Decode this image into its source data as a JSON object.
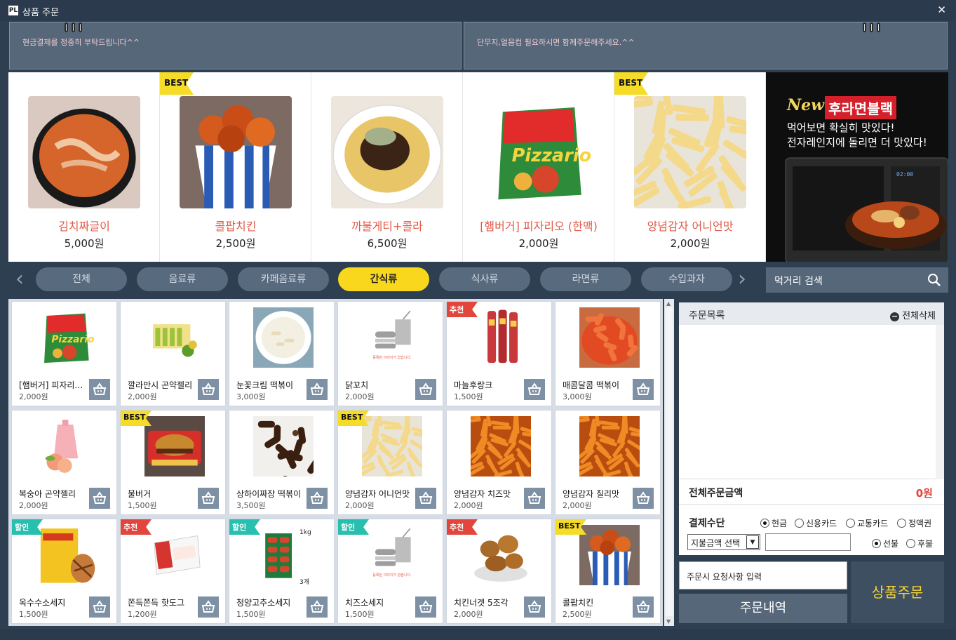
{
  "window": {
    "title": "상품 주문",
    "close_label": "✕"
  },
  "notices": [
    "현금결제를 정중히 부탁드립니다^^",
    "단무지,얼음컵 필요하시면 함께주문해주세요.^^"
  ],
  "featured": [
    {
      "name": "김치짜글이",
      "price": "5,000원",
      "badge": "",
      "img": "stew"
    },
    {
      "name": "콜팝치킨",
      "price": "2,500원",
      "badge": "BEST",
      "img": "cup"
    },
    {
      "name": "까불게티+콜라",
      "price": "6,500원",
      "badge": "",
      "img": "noodle"
    },
    {
      "name": "[햄버거] 피자리오 (한맥)",
      "price": "2,000원",
      "badge": "",
      "img": "package"
    },
    {
      "name": "양념감자 어니언맛",
      "price": "2,000원",
      "badge": "BEST",
      "img": "fries"
    }
  ],
  "banner": {
    "new_label": "New",
    "product": "후라면블랙",
    "line1": "먹어보면 확실히 맛있다!",
    "line2": "전자레인지에 돌리면 더 맛있다!",
    "clock": "02:00"
  },
  "categories": [
    "전체",
    "음료류",
    "카페음료류",
    "간식류",
    "식사류",
    "라면류",
    "수입과자"
  ],
  "active_category": 3,
  "search": {
    "placeholder": "먹거리 검색"
  },
  "items": [
    {
      "name": "[햄버거] 피자리오 (한맥)",
      "price": "2,000원",
      "tag": "",
      "img": "package"
    },
    {
      "name": "깔라만시 곤약젤리",
      "price": "2,000원",
      "tag": "",
      "img": "jellybox"
    },
    {
      "name": "눈꽃크림 떡볶이",
      "price": "3,000원",
      "tag": "",
      "img": "creamtteok"
    },
    {
      "name": "닭꼬치",
      "price": "2,000원",
      "tag": "",
      "img": "placeholder"
    },
    {
      "name": "마늘후랑크",
      "price": "1,500원",
      "tag": "추천",
      "img": "sausages"
    },
    {
      "name": "매콤달콤 떡볶이",
      "price": "3,000원",
      "tag": "",
      "img": "tteok"
    },
    {
      "name": "복숭아 곤약젤리",
      "price": "2,000원",
      "tag": "",
      "img": "peach"
    },
    {
      "name": "불버거",
      "price": "1,500원",
      "tag": "BEST",
      "img": "burger"
    },
    {
      "name": "상하이짜장 떡볶이",
      "price": "3,500원",
      "tag": "",
      "img": "jjajang"
    },
    {
      "name": "양념감자 어니언맛",
      "price": "2,000원",
      "tag": "BEST",
      "img": "fries"
    },
    {
      "name": "양념감자 치즈맛",
      "price": "2,000원",
      "tag": "",
      "img": "friesorange"
    },
    {
      "name": "양념감자 칠리맛",
      "price": "2,000원",
      "tag": "",
      "img": "friesorange"
    },
    {
      "name": "옥수수소세지",
      "price": "1,500원",
      "tag": "할인",
      "img": "corndog"
    },
    {
      "name": "쫀득쫀득 핫도그",
      "price": "1,200원",
      "tag": "추천",
      "img": "hotdog"
    },
    {
      "name": "청양고추소세지",
      "price": "1,500원",
      "tag": "할인",
      "img": "greenbox"
    },
    {
      "name": "치즈소세지",
      "price": "1,500원",
      "tag": "할인",
      "img": "placeholder"
    },
    {
      "name": "치킨너겟 5조각",
      "price": "2,000원",
      "tag": "추천",
      "img": "nuggets"
    },
    {
      "name": "콜팝치킨",
      "price": "2,500원",
      "tag": "BEST",
      "img": "cup"
    }
  ],
  "image_texts": {
    "placeholder": "등록된 이미지가 없습니다.",
    "greenbox_weight": "1kg",
    "greenbox_count": "3개"
  },
  "order": {
    "header": "주문목록",
    "clear_label": "전체삭제",
    "total_label": "전체주문금액",
    "total_value": "0원",
    "pay_label": "결제수단",
    "methods": [
      "현금",
      "신용카드",
      "교통카드",
      "정액권"
    ],
    "selected_method": 0,
    "amount_select": "지불금액 선택",
    "timing": [
      "선불",
      "후불"
    ],
    "selected_timing": 0,
    "request_placeholder": "주문시 요청사항 입력",
    "history_label": "주문내역",
    "order_label": "상품주문"
  },
  "colors": {
    "accent": "#f9d71c",
    "price_red": "#e25a48",
    "frame": "#2f3f52",
    "panel": "#56677a"
  }
}
